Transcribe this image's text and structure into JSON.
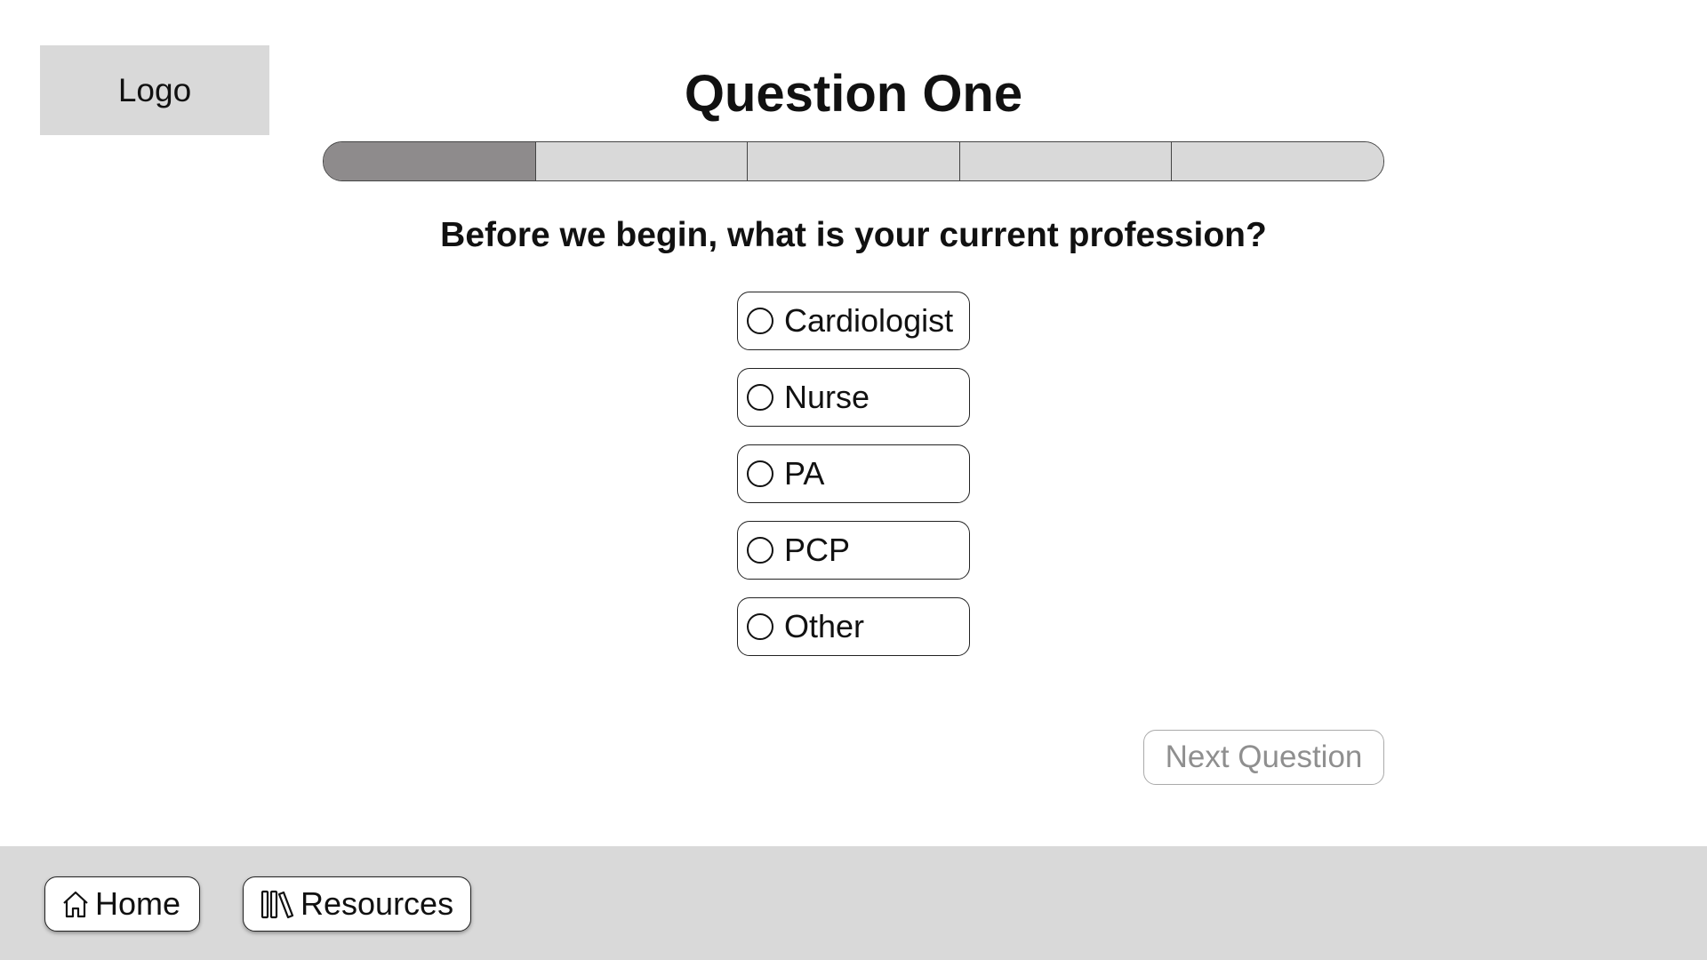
{
  "logo": {
    "label": "Logo"
  },
  "header": {
    "title": "Question One"
  },
  "progress": {
    "total_steps": 5,
    "current_step": 1
  },
  "question": {
    "text": "Before we begin, what is your current profession?",
    "options": [
      {
        "label": "Cardiologist"
      },
      {
        "label": "Nurse"
      },
      {
        "label": "PA"
      },
      {
        "label": "PCP"
      },
      {
        "label": "Other"
      }
    ]
  },
  "actions": {
    "next_label": "Next Question"
  },
  "footer": {
    "home_label": "Home",
    "home_icon": "home-icon",
    "resources_label": "Resources",
    "resources_icon": "library-icon"
  },
  "colors": {
    "progress_filled": "#8e8b8c",
    "progress_empty": "#d9d9d9",
    "footer_bg": "#d9d9d9",
    "disabled_text": "#8f8f8f"
  }
}
